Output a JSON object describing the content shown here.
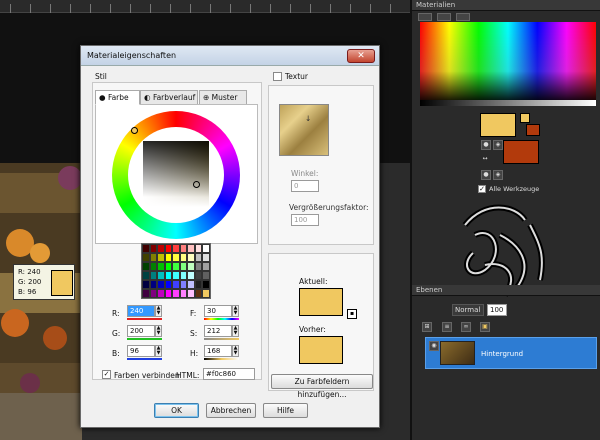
{
  "dialog": {
    "title": "Materialeigenschaften",
    "close_label": "✕",
    "style_label": "Stil",
    "tabs": [
      "Farbe",
      "Farbverlauf",
      "Muster"
    ],
    "texture_label": "Textur",
    "angle_label": "Winkel:",
    "angle_value": "0",
    "scale_label": "Vergrößerungsfaktor:",
    "scale_value": "100",
    "current_label": "Aktuell:",
    "previous_label": "Vorher:",
    "current_color": "#f0c860",
    "previous_color": "#f0c860",
    "fields": {
      "R": "240",
      "G": "200",
      "B": "96",
      "F": "30",
      "S": "212",
      "H": "168"
    },
    "labels": {
      "R": "R:",
      "G": "G:",
      "B": "B:",
      "F": "F:",
      "S": "S:",
      "H": "H:"
    },
    "link_colors_label": "Farben verbinden",
    "html_label": "HTML:",
    "html_value": "#f0c860",
    "add_to_swatches": "Zu Farbfeldern hinzufügen...",
    "ok": "OK",
    "cancel": "Abbrechen",
    "help": "Hilfe"
  },
  "tooltip": {
    "r": "R: 240",
    "g": "G: 200",
    "b": "B: 96",
    "swatch": "#f0c860"
  },
  "materials": {
    "title": "Materialien",
    "fg_color": "#f0c860",
    "bg_color": "#b23a0c",
    "all_tools_label": "Alle Werkzeuge"
  },
  "layers": {
    "title": "Ebenen",
    "blend_mode": "Normal",
    "opacity": "100",
    "layer_name": "Hintergrund"
  },
  "icons": {
    "close": "close-icon",
    "info": "info-icon"
  }
}
